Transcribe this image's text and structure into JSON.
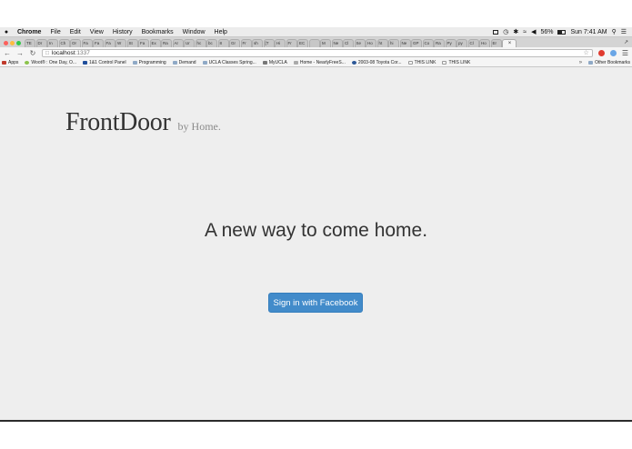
{
  "menubar": {
    "app": "Chrome",
    "items": [
      "File",
      "Edit",
      "View",
      "History",
      "Bookmarks",
      "Window",
      "Help"
    ],
    "battery": "56%",
    "clock": "Sun 7:41 AM"
  },
  "tabs": [
    "TE",
    "Dr",
    "In",
    "Ch",
    "Or",
    "Fa",
    "Fa",
    "Fa",
    "W",
    "St",
    "Fa",
    "Ex",
    "Ra",
    "Ar",
    "Ur",
    "hc",
    "bc",
    "8",
    "Gr",
    "Fr",
    "sh",
    "[T",
    "Hi",
    "Fr",
    "EC",
    "",
    "M",
    "Ne",
    "Cl",
    "Se",
    "Ho",
    "ht",
    "hi",
    "Ne",
    "GP",
    "Co",
    "Ra",
    "Py",
    "py",
    "Cl",
    "Ho",
    "Er"
  ],
  "active_tab_close": "×",
  "address": {
    "host": "localhost",
    "port": ":1337"
  },
  "apps_label": "Apps",
  "bookmarks": [
    "Woot® : One Day, O...",
    "1&1 Control Panel",
    "Programming",
    "Demand",
    "UCLA Classes Spring...",
    "MyUCLA",
    "Home - NearlyFreeS...",
    "2003-08 Toyota Cor...",
    "THIS LINK",
    "THIS LINK"
  ],
  "other_bookmarks": "Other Bookmarks",
  "page": {
    "brand": "FrontDoor",
    "by_line": "by Home.",
    "tagline": "A new way to come home.",
    "signin_label": "Sign in with Facebook"
  },
  "colors": {
    "page_bg": "#eeeeee",
    "button": "#428bca",
    "text": "#333333"
  }
}
